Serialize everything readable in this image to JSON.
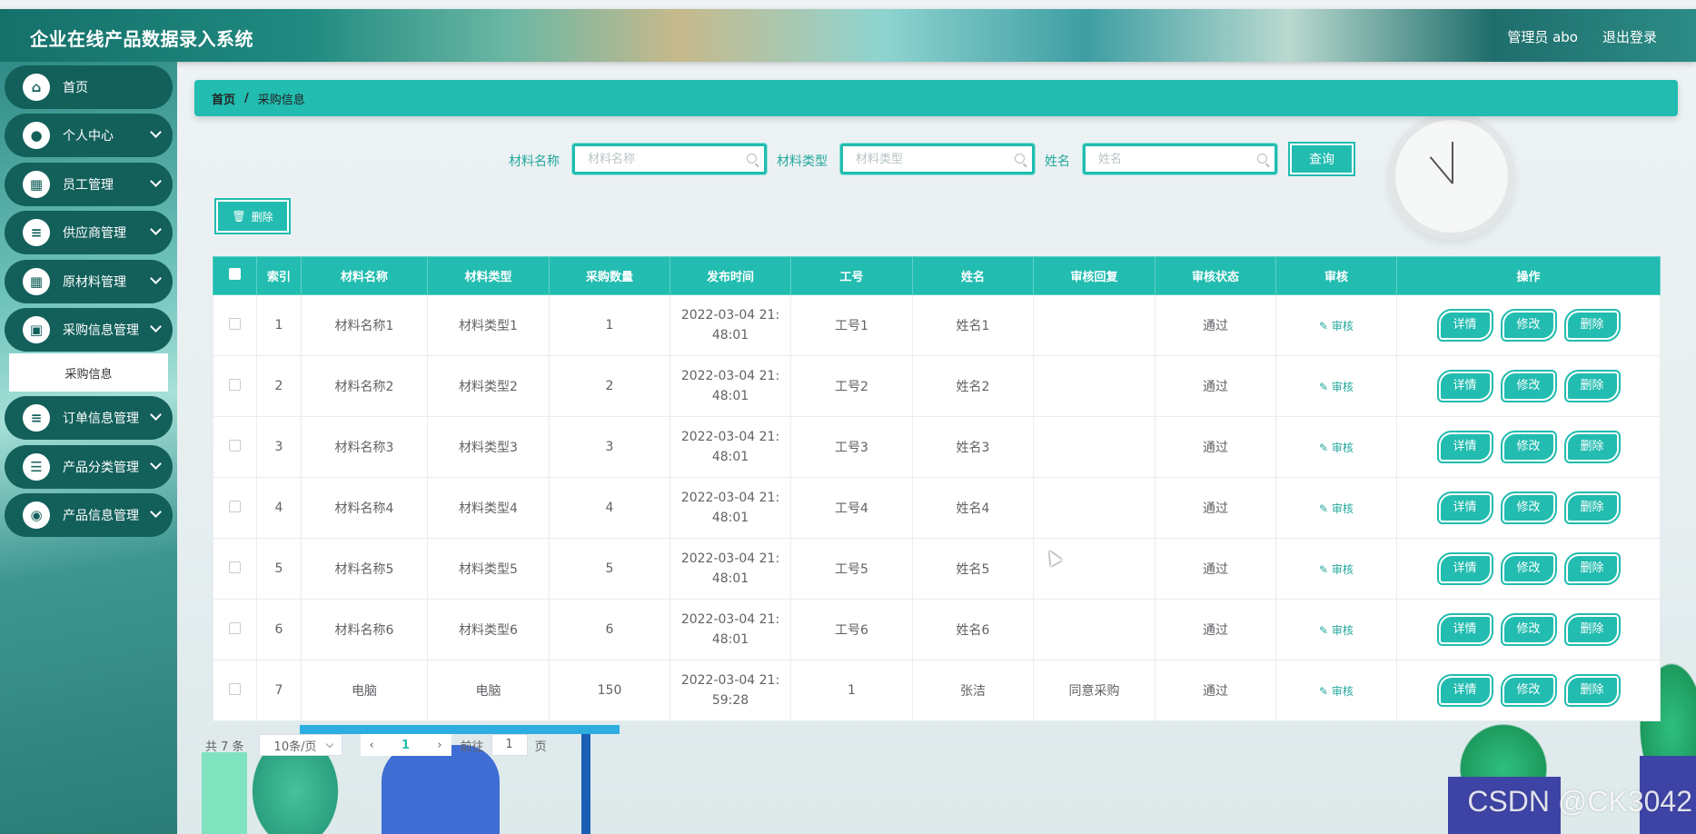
{
  "header": {
    "title": "企业在线产品数据录入系统",
    "user": "管理员 abo",
    "logout": "退出登录"
  },
  "sidebar": {
    "items": [
      {
        "label": "首页",
        "icon": "home-icon"
      },
      {
        "label": "个人中心",
        "icon": "user-icon"
      },
      {
        "label": "员工管理",
        "icon": "grid-icon"
      },
      {
        "label": "供应商管理",
        "icon": "list-icon"
      },
      {
        "label": "原材料管理",
        "icon": "grid-icon"
      },
      {
        "label": "采购信息管理",
        "icon": "briefcase-icon"
      },
      {
        "label": "订单信息管理",
        "icon": "list-icon"
      },
      {
        "label": "产品分类管理",
        "icon": "sliders-icon"
      },
      {
        "label": "产品信息管理",
        "icon": "bulb-icon"
      }
    ],
    "submenu": {
      "label": "采购信息"
    }
  },
  "breadcrumb": {
    "home": "首页",
    "separator": "/",
    "current": "采购信息"
  },
  "search": {
    "material_name_label": "材料名称",
    "material_name_placeholder": "材料名称",
    "material_type_label": "材料类型",
    "material_type_placeholder": "材料类型",
    "name_label": "姓名",
    "name_placeholder": "姓名",
    "query_button": "查询"
  },
  "toolbar": {
    "delete_button": "删除"
  },
  "table": {
    "headers": [
      "索引",
      "材料名称",
      "材料类型",
      "采购数量",
      "发布时间",
      "工号",
      "姓名",
      "审核回复",
      "审核状态",
      "审核",
      "操作"
    ],
    "audit_label": "审核",
    "op_labels": {
      "detail": "详情",
      "edit": "修改",
      "delete": "删除"
    },
    "rows": [
      {
        "index": "1",
        "material_name": "材料名称1",
        "material_type": "材料类型1",
        "quantity": "1",
        "time": "2022-03-04 21:48:01",
        "job_no": "工号1",
        "name": "姓名1",
        "reply": "",
        "status": "通过"
      },
      {
        "index": "2",
        "material_name": "材料名称2",
        "material_type": "材料类型2",
        "quantity": "2",
        "time": "2022-03-04 21:48:01",
        "job_no": "工号2",
        "name": "姓名2",
        "reply": "",
        "status": "通过"
      },
      {
        "index": "3",
        "material_name": "材料名称3",
        "material_type": "材料类型3",
        "quantity": "3",
        "time": "2022-03-04 21:48:01",
        "job_no": "工号3",
        "name": "姓名3",
        "reply": "",
        "status": "通过"
      },
      {
        "index": "4",
        "material_name": "材料名称4",
        "material_type": "材料类型4",
        "quantity": "4",
        "time": "2022-03-04 21:48:01",
        "job_no": "工号4",
        "name": "姓名4",
        "reply": "",
        "status": "通过"
      },
      {
        "index": "5",
        "material_name": "材料名称5",
        "material_type": "材料类型5",
        "quantity": "5",
        "time": "2022-03-04 21:48:01",
        "job_no": "工号5",
        "name": "姓名5",
        "reply": "",
        "status": "通过"
      },
      {
        "index": "6",
        "material_name": "材料名称6",
        "material_type": "材料类型6",
        "quantity": "6",
        "time": "2022-03-04 21:48:01",
        "job_no": "工号6",
        "name": "姓名6",
        "reply": "",
        "status": "通过"
      },
      {
        "index": "7",
        "material_name": "电脑",
        "material_type": "电脑",
        "quantity": "150",
        "time": "2022-03-04 21:59:28",
        "job_no": "1",
        "name": "张洁",
        "reply": "同意采购",
        "status": "通过"
      }
    ]
  },
  "pagination": {
    "total": "共 7 条",
    "page_size": "10条/页",
    "current_page": "1",
    "goto_label": "前往",
    "goto_value": "1",
    "page_suffix": "页"
  },
  "watermark": "CSDN @CK3042",
  "colors": {
    "accent": "#22bcb0",
    "sidebar_item": "#13605b"
  }
}
